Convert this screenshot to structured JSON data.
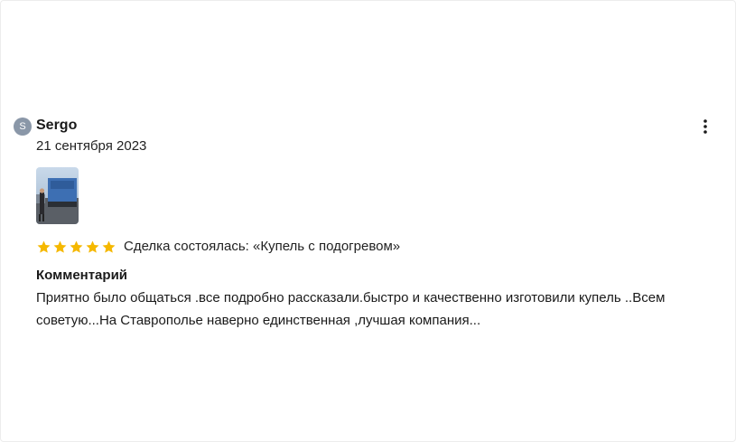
{
  "review": {
    "avatar_letter": "S",
    "author": "Sergo",
    "date": "21 сентября 2023",
    "photo_icon": "photo-thumbnail",
    "more_icon": "vertical-dots-icon",
    "rating": {
      "value": 5,
      "max": 5,
      "star_color": "#f5b800"
    },
    "deal_text": "Сделка состоялась: «Купель с подогревом»",
    "comment_title": "Комментарий",
    "comment_text": "Приятно было общаться .все подробно рассказали.быстро и качественно изготовили купель ..Всем советую...На Ставрополье наверно единственная ,лучшая компания..."
  }
}
